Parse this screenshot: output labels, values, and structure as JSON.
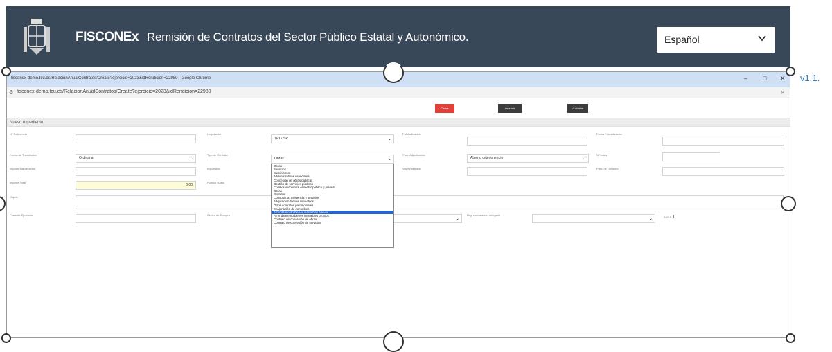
{
  "header": {
    "brand": "FISCONEx",
    "subtitle": "Remisión de Contratos del Sector Público Estatal y Autonómico.",
    "language": {
      "selected": "Español"
    },
    "version": "v1.1."
  },
  "browser": {
    "window_title": "fisconex-demo.tcu.es/RelacionAnualContratos/Create?ejercicio=2023&idRendicion=22980 - Google Chrome",
    "url": "fisconex-demo.tcu.es/RelacionAnualContratos/Create?ejercicio=2023&idRendicion=22980"
  },
  "toolbar": {
    "cancel": "Cerrar",
    "print": "Imprimir",
    "save": "✓ Grabar"
  },
  "colors": {
    "header_bg": "#384858",
    "cancel": "#e0413a",
    "dark_btn": "#3c3c3c",
    "selected_option": "#2863c7",
    "highlight_field": "#fdfbd8",
    "version_link": "#2e7fc0"
  },
  "form": {
    "section_title": "Nuevo expediente",
    "labels": {
      "ref": "Nº Referencia",
      "legislacion": "Legislación",
      "f_adjudicacion": "F. Adjudicación",
      "fecha_formalizacion": "Fecha Formalización",
      "forma_tramitacion": "Forma de Tramitación",
      "tipo_contrato": "Tipo de Contrato",
      "proc_adjudicacion": "Proc. Adjudicación",
      "n_lotes": "Nº Lotes",
      "importe_adjudicacion": "Importe Adjudicación",
      "impuestos": "Impuestos",
      "valor_estimado": "Valor Estimado",
      "pres_licitacion": "Pres. de Licitación",
      "importe_total": "Importe Total",
      "publico_gasto": "Público Gasto",
      "objeto": "Objeto",
      "plazo_ejecucion": "Plazo de Ejecución",
      "centro_compra": "Centro de Compra",
      "org_contratacion": "Org. contratación delegado",
      "samm": "SARA"
    },
    "values": {
      "legislacion": "TRLCSP",
      "forma_tramitacion": "Ordinaria",
      "tipo_contrato": "Obras",
      "proc_adjudicacion": "Abierto criterio precio",
      "importe_total": "0,00"
    },
    "tipo_contrato_options": [
      "Obras",
      "Servicios",
      "Suministros",
      "Administrativos especiales",
      "Concesión de obras públicas",
      "Gestión de servicios públicos",
      "Colaboración entre el sector público y privado",
      "Obras",
      "Privados",
      "Consultoría, asistencia y servicios",
      "Adquisición bienes inmuebles",
      "Otros contratos patrimoniales",
      "Enajenación de inmuebles",
      "Arrendamiento bienes inmuebles ajenos",
      "Arrendamiento bienes inmuebles propios",
      "Contrato de concesión de obras",
      "Contrato de concesión de servicios"
    ],
    "selected_option": "Arrendamiento bienes inmuebles ajenos"
  }
}
